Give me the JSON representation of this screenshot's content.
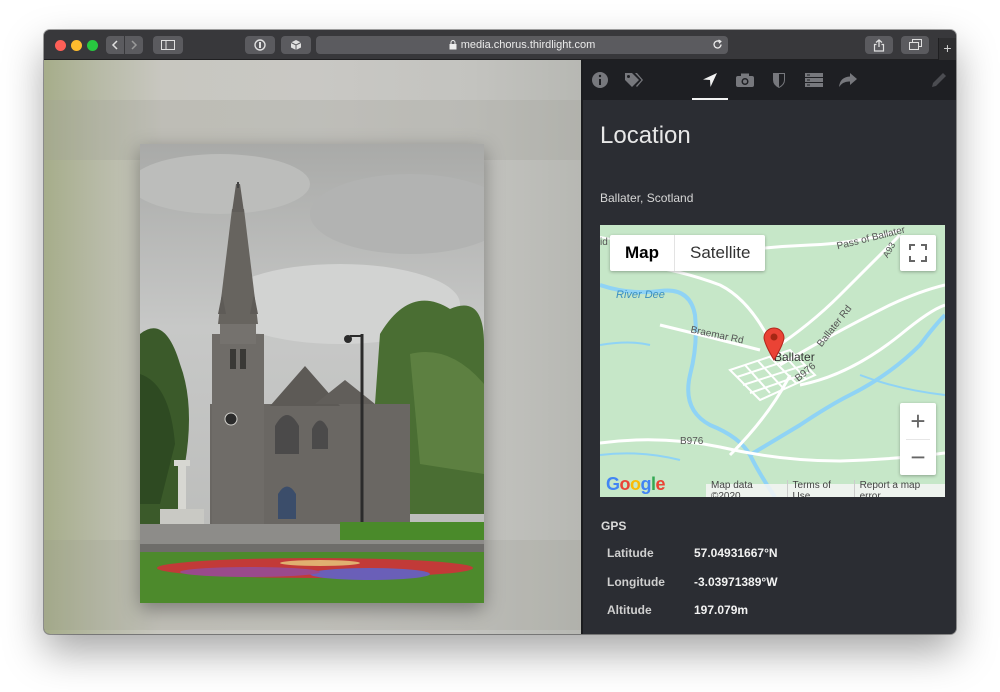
{
  "browser": {
    "url": "media.chorus.thirdlight.com",
    "new_tab_label": "+"
  },
  "panel": {
    "tabs": [
      {
        "icon": "info-icon",
        "active": false
      },
      {
        "icon": "tags-icon",
        "active": false
      },
      {
        "icon": "location-arrow-icon",
        "active": true
      },
      {
        "icon": "camera-icon",
        "active": false
      },
      {
        "icon": "shield-icon",
        "active": false
      },
      {
        "icon": "metadata-list-icon",
        "active": false
      },
      {
        "icon": "share-arrow-icon",
        "active": false
      },
      {
        "icon": "pencil-icon",
        "active": false
      }
    ],
    "title": "Location",
    "place": "Ballater, Scotland"
  },
  "map": {
    "type_options": [
      "Map",
      "Satellite"
    ],
    "selected_type": "Map",
    "zoom_in": "+",
    "zoom_out": "−",
    "logo": "Google",
    "attribution": [
      "Map data ©2020",
      "Terms of Use",
      "Report a map error"
    ],
    "labels": {
      "river": "River Dee",
      "town": "Ballater",
      "pass": "Pass of Ballater",
      "braemar": "Braemar Rd",
      "ballater_rd": "Ballater Rd",
      "b976_a": "B976",
      "b976_b": "B976",
      "a93": "A93",
      "edge": "id"
    }
  },
  "gps": {
    "title": "GPS",
    "rows": [
      {
        "key": "Latitude",
        "value": "57.04931667°N"
      },
      {
        "key": "Longitude",
        "value": "-3.03971389°W"
      },
      {
        "key": "Altitude",
        "value": "197.079m"
      }
    ]
  },
  "colors": {
    "panel_bg": "#2b2d33",
    "tab_bar_bg": "#1e1f23",
    "map_land": "#c6e7c8",
    "map_water": "#8fd3f5",
    "map_road": "#ffffff",
    "marker": "#ea4335"
  }
}
